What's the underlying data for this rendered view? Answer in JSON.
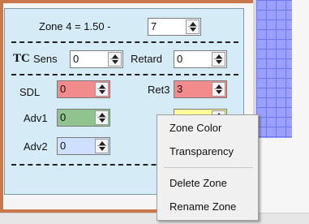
{
  "zone_panel": {
    "zone_label": "Zone 4 = 1.50 -",
    "zone_value": "7",
    "tc_label": "TC",
    "sens_label": "Sens",
    "sens_value": "0",
    "retard_label": "Retard",
    "retard_value": "0",
    "sdl_label": "SDL",
    "sdl_value": "0",
    "ret3_label": "Ret3",
    "ret3_value": "3",
    "adv1_label": "Adv1",
    "adv1_value": "0",
    "adv2_label": "Adv2",
    "adv2_value": "0"
  },
  "context_menu": {
    "items": [
      "Zone Color",
      "Transparency",
      "Delete Zone",
      "Rename Zone"
    ]
  },
  "colors": {
    "panel_background": "#d5ecf6",
    "sdl_field": "#f28b8b",
    "ret3_field": "#f28b8b",
    "adv1_field": "#8fc48f",
    "adv2_field": "#cfe0ff",
    "hidden_field": "#ffff99",
    "grid": "#9aa0ff",
    "frame": "#c8784a"
  },
  "icons": {
    "spin_buttons": "up-down-arrow-icon"
  }
}
